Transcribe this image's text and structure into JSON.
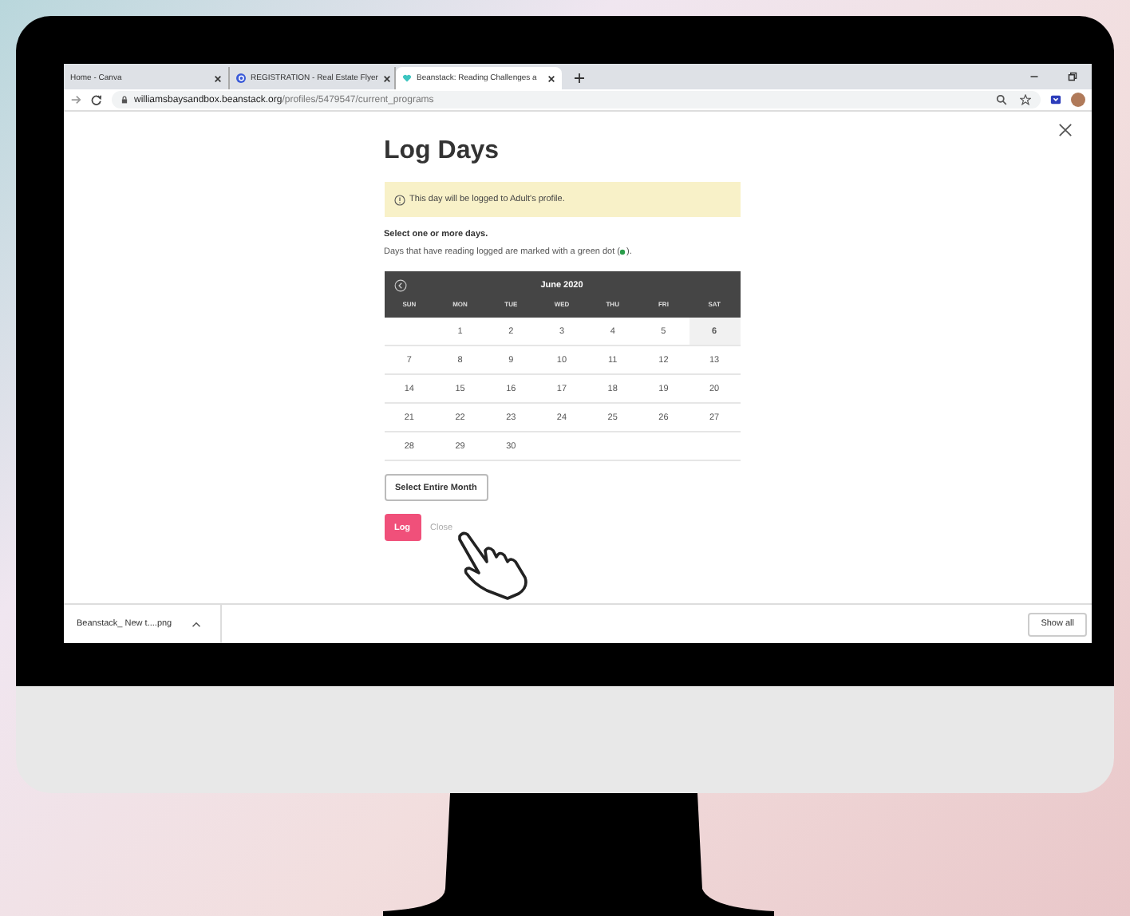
{
  "browser": {
    "tabs": [
      {
        "title": "Home - Canva",
        "selected": false
      },
      {
        "title": "REGISTRATION - Real Estate Flyer",
        "selected": false
      },
      {
        "title": "Beanstack: Reading Challenges a",
        "selected": true
      }
    ],
    "url_host": "williamsbaysandbox.beanstack.org",
    "url_path": "/profiles/5479547/current_programs"
  },
  "dialog": {
    "title": "Log Days",
    "alert": "This day will be logged to Adult's profile.",
    "instruction": "Select one or more days.",
    "note": "Days that have reading logged are marked with a green dot (",
    "note_end": ").",
    "calendar": {
      "month": "June 2020",
      "weekdays": [
        "SUN",
        "MON",
        "TUE",
        "WED",
        "THU",
        "FRI",
        "SAT"
      ],
      "weeks": [
        [
          {
            "day": "1",
            "selected": false
          },
          {
            "day": "2",
            "selected": false
          },
          {
            "day": "3",
            "selected": false
          },
          {
            "day": "4",
            "selected": false
          },
          {
            "day": "5",
            "selected": false
          },
          {
            "day": "6",
            "selected": true
          }
        ],
        [
          {
            "day": "7",
            "selected": false
          },
          {
            "day": "8",
            "selected": false
          },
          {
            "day": "9",
            "selected": false
          },
          {
            "day": "10",
            "selected": false
          },
          {
            "day": "11",
            "selected": false
          },
          {
            "day": "12",
            "selected": false
          },
          {
            "day": "13",
            "selected": false
          }
        ],
        [
          {
            "day": "14",
            "selected": false
          },
          {
            "day": "15",
            "selected": false
          },
          {
            "day": "16",
            "selected": false
          },
          {
            "day": "17",
            "selected": false
          },
          {
            "day": "18",
            "selected": false
          },
          {
            "day": "19",
            "selected": false
          },
          {
            "day": "20",
            "selected": false
          }
        ],
        [
          {
            "day": "21",
            "selected": false
          },
          {
            "day": "22",
            "selected": false
          },
          {
            "day": "23",
            "selected": false
          },
          {
            "day": "24",
            "selected": false
          },
          {
            "day": "25",
            "selected": false
          },
          {
            "day": "26",
            "selected": false
          },
          {
            "day": "27",
            "selected": false
          }
        ],
        [
          {
            "day": "28",
            "selected": false
          },
          {
            "day": "29",
            "selected": false
          },
          {
            "day": "30",
            "selected": false
          }
        ]
      ]
    },
    "select_month": "Select Entire Month",
    "log": "Log",
    "close": "Close"
  },
  "download_bar": {
    "file": "Beanstack_ New t....png",
    "show_all": "Show all"
  }
}
